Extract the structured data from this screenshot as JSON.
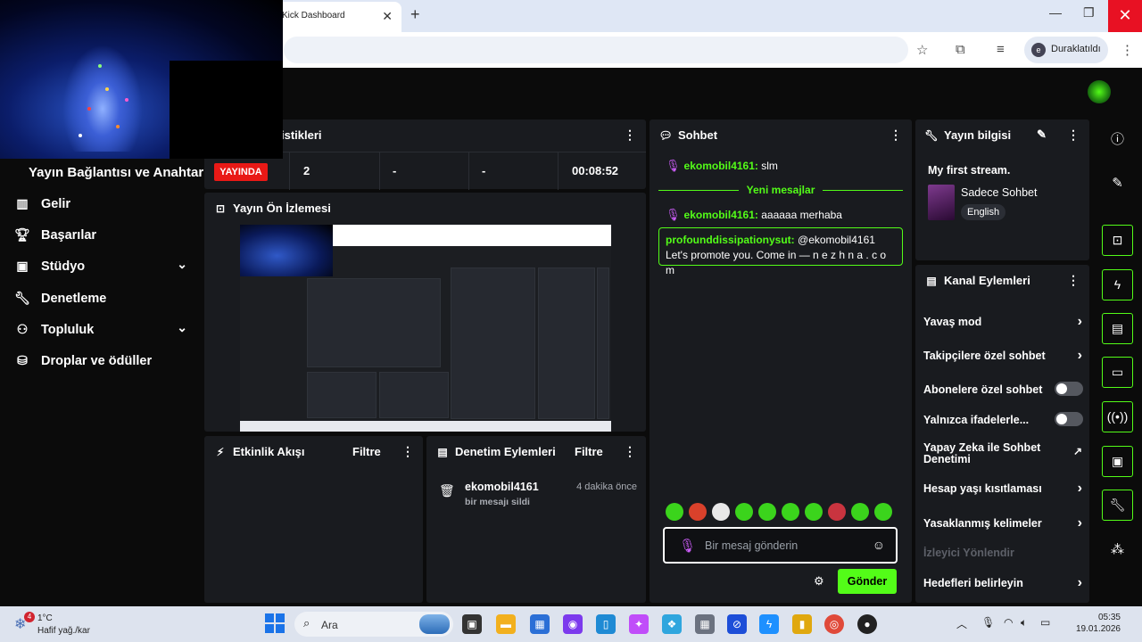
{
  "browser": {
    "tab_title": "Kick Dashboard",
    "profile_initial": "e",
    "profile_label": "Duraklatıldı"
  },
  "sidebar": {
    "section_title": "Yayın Bağlantısı ve Anahtarı",
    "items": [
      {
        "label": "Gelir",
        "icon": "chart-icon"
      },
      {
        "label": "Başarılar",
        "icon": "trophy-icon"
      },
      {
        "label": "Stüdyo",
        "icon": "studio-icon",
        "expandable": true
      },
      {
        "label": "Denetleme",
        "icon": "wrench-icon"
      },
      {
        "label": "Topluluk",
        "icon": "community-icon",
        "expandable": true
      },
      {
        "label": "Droplar ve ödüller",
        "icon": "gift-icon"
      }
    ]
  },
  "stats": {
    "title": "istikleri",
    "live_label": "YAYINDA",
    "viewers": "2",
    "col2": "-",
    "col3": "-",
    "duration": "00:08:52"
  },
  "preview": {
    "title": "Yayın Ön İzlemesi"
  },
  "activity": {
    "title": "Etkinlik Akışı",
    "filter": "Filtre"
  },
  "mod_actions": {
    "title": "Denetim Eylemleri",
    "filter": "Filtre",
    "entry": {
      "user": "ekomobil4161",
      "action": "bir mesajı sildi",
      "time": "4 dakika önce"
    }
  },
  "chat": {
    "title": "Sohbet",
    "messages": [
      {
        "user": "ekomobil4161",
        "text": "slm"
      },
      {
        "user": "ekomobil4161",
        "text": "aaaaaa merhaba"
      }
    ],
    "new_messages_label": "Yeni mesajlar",
    "highlight": {
      "user": "profounddissipationysut",
      "text": "@ekomobil4161 Let's promote you. Come in — n e z h  n a . c o m"
    },
    "input_placeholder": "Bir mesaj gönderin",
    "send_label": "Gönder"
  },
  "stream_info": {
    "title": "Yayın bilgisi",
    "stream_title": "My first stream.",
    "category": "Sadece Sohbet",
    "language": "English"
  },
  "channel_actions": {
    "title": "Kanal Eylemleri",
    "items": [
      {
        "label": "Yavaş mod",
        "control": "arrow"
      },
      {
        "label": "Takipçilere özel sohbet",
        "control": "arrow"
      },
      {
        "label": "Abonelere özel sohbet",
        "control": "toggle"
      },
      {
        "label": "Yalnızca ifadelerle...",
        "control": "toggle"
      },
      {
        "label": "Yapay Zeka ile Sohbet Denetimi",
        "control": "external"
      },
      {
        "label": "Hesap yaşı kısıtlaması",
        "control": "arrow"
      },
      {
        "label": "Yasaklanmış kelimeler",
        "control": "arrow"
      },
      {
        "label": "İzleyici Yönlendir",
        "control": "disabled"
      },
      {
        "label": "Hedefleri belirleyin",
        "control": "arrow"
      }
    ]
  },
  "taskbar": {
    "temp": "1°C",
    "weather": "Hafif yağ./kar",
    "weather_badge": "4",
    "search": "Ara",
    "time": "05:35",
    "date": "19.01.2026"
  },
  "colors": {
    "accent": "#53fc18",
    "live": "#e91916",
    "panel": "#191b1f",
    "mic": "#c95cf5"
  }
}
